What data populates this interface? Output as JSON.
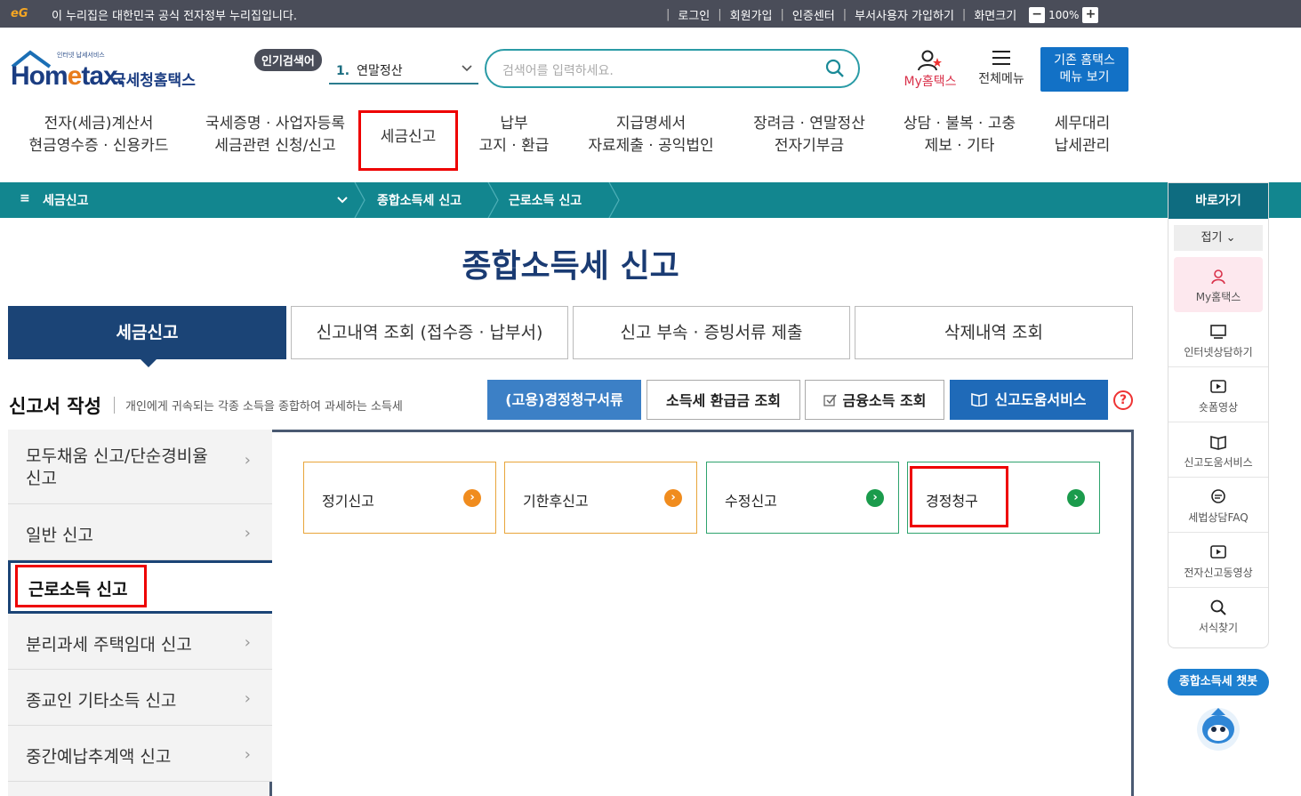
{
  "topbar": {
    "logo_text": "eG",
    "notice": "이 누리집은 대한민국 공식 전자정부 누리집입니다.",
    "links": [
      "로그인",
      "회원가입",
      "인증센터",
      "부서사용자 가입하기",
      "화면크기"
    ],
    "zoom": "100%",
    "zoom_minus": "−",
    "zoom_plus": "+"
  },
  "header": {
    "logo_small": "인터넷 납세서비스",
    "logo_home": "Hom",
    "logo_e": "e",
    "logo_tax": "tax.",
    "logo_ko": "국세청홈택스",
    "popular_label": "인기검색어",
    "popular_num": "1.",
    "popular_value": "연말정산",
    "search_placeholder": "검색어를 입력하세요.",
    "my_home": "My홈택스",
    "all_menu": "전체메뉴",
    "old_menu_line1": "기존 홈택스",
    "old_menu_line2": "메뉴 보기"
  },
  "gnb": [
    {
      "line1": "전자(세금)계산서",
      "line2": "현금영수증 · 신용카드"
    },
    {
      "line1": "국세증명 · 사업자등록",
      "line2": "세금관련 신청/신고"
    },
    {
      "line1": "세금신고",
      "line2": ""
    },
    {
      "line1": "납부",
      "line2": "고지 · 환급"
    },
    {
      "line1": "지급명세서",
      "line2": "자료제출 · 공익법인"
    },
    {
      "line1": "장려금 · 연말정산",
      "line2": "전자기부금"
    },
    {
      "line1": "상담 · 불복 · 고충",
      "line2": "제보 · 기타"
    },
    {
      "line1": "세무대리",
      "line2": "납세관리"
    }
  ],
  "pathbar": {
    "menu_icon": "≡",
    "menu": "세금신고",
    "crumb1": "종합소득세 신고",
    "crumb2": "근로소득 신고"
  },
  "quick": {
    "title": "바로가기",
    "fold": "접기",
    "items": [
      "My홈택스",
      "인터넷상담하기",
      "숏폼영상",
      "신고도움서비스",
      "세법상담FAQ",
      "전자신고동영상",
      "서식찾기"
    ]
  },
  "chatbot": "종합소득세 챗봇",
  "page_title": "종합소득세 신고",
  "tabs": [
    "세금신고",
    "신고내역 조회 (접수증 · 납부서)",
    "신고 부속 · 증빙서류 제출",
    "삭제내역 조회"
  ],
  "section": {
    "title": "신고서 작성",
    "desc": "개인에게 귀속되는 각종 소득을 종합하여 과세하는 소득세"
  },
  "buttons": {
    "claim": "(고용)경정청구서류",
    "refund": "소득세 환급금 조회",
    "finance": "금융소득 조회",
    "help_service": "신고도움서비스",
    "help": "?"
  },
  "side_menu": [
    {
      "label": "모두채움 신고/단순경비율 신고"
    },
    {
      "label": "일반 신고"
    },
    {
      "label": "근로소득 신고"
    },
    {
      "label": "분리과세 주택임대 신고"
    },
    {
      "label": "종교인 기타소득 신고"
    },
    {
      "label": "중간예납추계액 신고"
    }
  ],
  "cards": [
    {
      "label": "정기신고",
      "status": "orange"
    },
    {
      "label": "기한후신고",
      "status": "orange"
    },
    {
      "label": "수정신고",
      "status": "green"
    },
    {
      "label": "경정청구",
      "status": "green"
    }
  ],
  "colors": {
    "primary": "#1b4476",
    "teal": "#12868f",
    "red_highlight": "#e00000"
  }
}
